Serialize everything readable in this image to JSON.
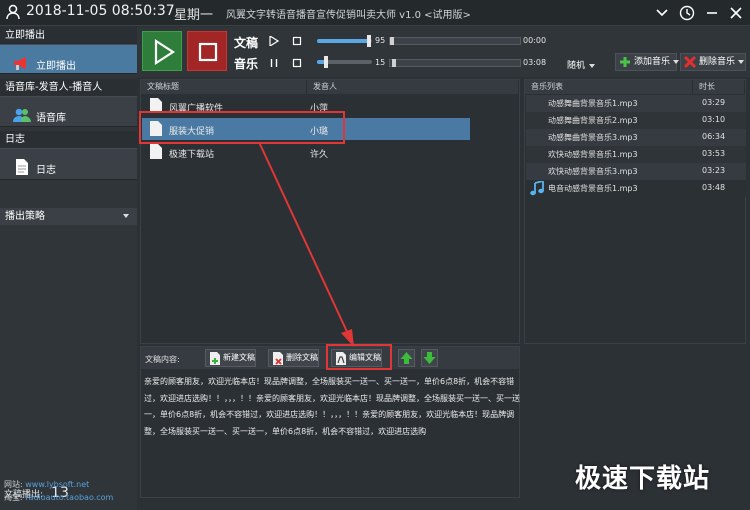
{
  "titlebar": {
    "datetime": "2018-11-05 08:50:37",
    "weekday": "星期一",
    "app_title": "风翼文字转语音播音宣传促销叫卖大师 v1.0 <试用版>"
  },
  "sidebar": {
    "section_play": "立即播出",
    "item_play": "立即播出",
    "section_voice": "语音库-发音人-播音人",
    "item_voice": "语音库",
    "section_log": "日志",
    "item_log": "日志",
    "strategy": "播出策略",
    "played_label": "文稿播出:",
    "played_count": "13",
    "website_label": "网站:",
    "website": "www.lybsoft.net",
    "taobao_label": "淘宝:",
    "taobao": "radioauto.taobao.com"
  },
  "controls": {
    "script_label": "文稿",
    "music_label": "音乐",
    "script_volume": "95",
    "music_volume": "15",
    "script_volume_level": 0.95,
    "music_volume_level": 0.15,
    "script_time": "00:00",
    "music_time": "03:08",
    "mode": "随机",
    "add_music": "添加音乐",
    "delete_music": "删除音乐"
  },
  "docs": {
    "col_title": "文稿标题",
    "col_speaker": "发音人",
    "rows": [
      {
        "title": "风翼广播软件",
        "speaker": "小萍"
      },
      {
        "title": "服装大促销",
        "speaker": "小璐"
      },
      {
        "title": "极速下载站",
        "speaker": "许久"
      }
    ]
  },
  "music": {
    "col_name": "音乐列表",
    "col_duration": "时长",
    "rows": [
      {
        "name": "动感舞曲背景音乐1.mp3",
        "duration": "03:29"
      },
      {
        "name": "动感舞曲背景音乐2.mp3",
        "duration": "03:10"
      },
      {
        "name": "动感舞曲背景音乐3.mp3",
        "duration": "06:34"
      },
      {
        "name": "欢快动感背景音乐1.mp3",
        "duration": "03:53"
      },
      {
        "name": "欢快动感背景音乐3.mp3",
        "duration": "03:23"
      },
      {
        "name": "电音动感背景音乐1.mp3",
        "duration": "03:48"
      }
    ]
  },
  "editor": {
    "label": "文稿内容:",
    "new_btn": "新建文稿",
    "delete_btn": "删除文稿",
    "edit_btn": "编辑文稿",
    "content": "亲爱的顾客朋友，欢迎光临本店！现品牌调整，全场服装买一送一、买一送一，单价6点8折，机会不容错过，欢迎进店选购！！，，，！！亲爱的顾客朋友，欢迎光临本店！现品牌调整，全场服装买一送一、买一送一，单价6点8折，机会不容错过，欢迎进店选购！！，，，！！亲爱的顾客朋友，欢迎光临本店！现品牌调整，全场服装买一送一、买一送一，单价6点8折，机会不容错过，欢迎进店选购"
  },
  "watermark": "极速下载站",
  "colors": {
    "accent": "#4a7aa3",
    "play": "#2f7d3a",
    "stop": "#a32626",
    "highlight": "#e03636"
  }
}
